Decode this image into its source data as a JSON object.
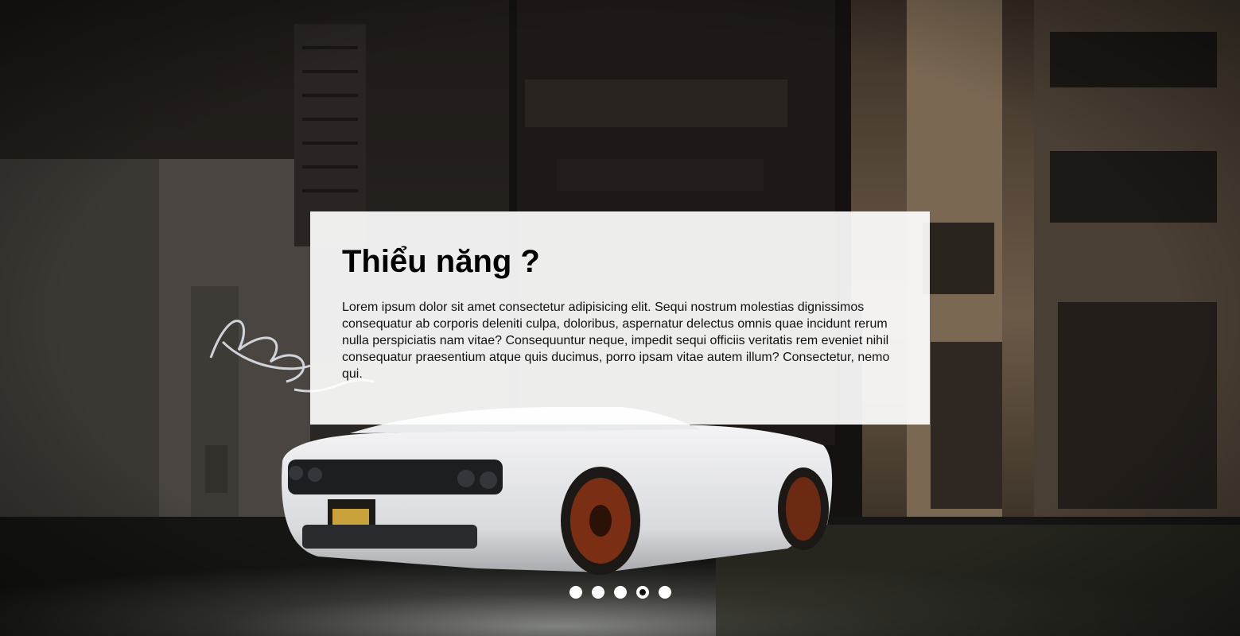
{
  "slide": {
    "title": "Thiểu năng ?",
    "text": "Lorem ipsum dolor sit amet consectetur adipisicing elit. Sequi nostrum molestias dignissimos consequatur ab corporis deleniti culpa, doloribus, aspernatur delectus omnis quae incidunt rerum nulla perspiciatis nam vitae? Consequuntur neque, impedit sequi officiis veritatis rem eveniet nihil consequatur praesentium atque quis ducimus, porro ipsam vitae autem illum? Consectetur, nemo qui."
  },
  "pagination": {
    "total": 5,
    "active_index": 3
  },
  "colors": {
    "card_background": "#ffffff",
    "dot": "#ffffff",
    "dot_active_center": "#111111"
  }
}
